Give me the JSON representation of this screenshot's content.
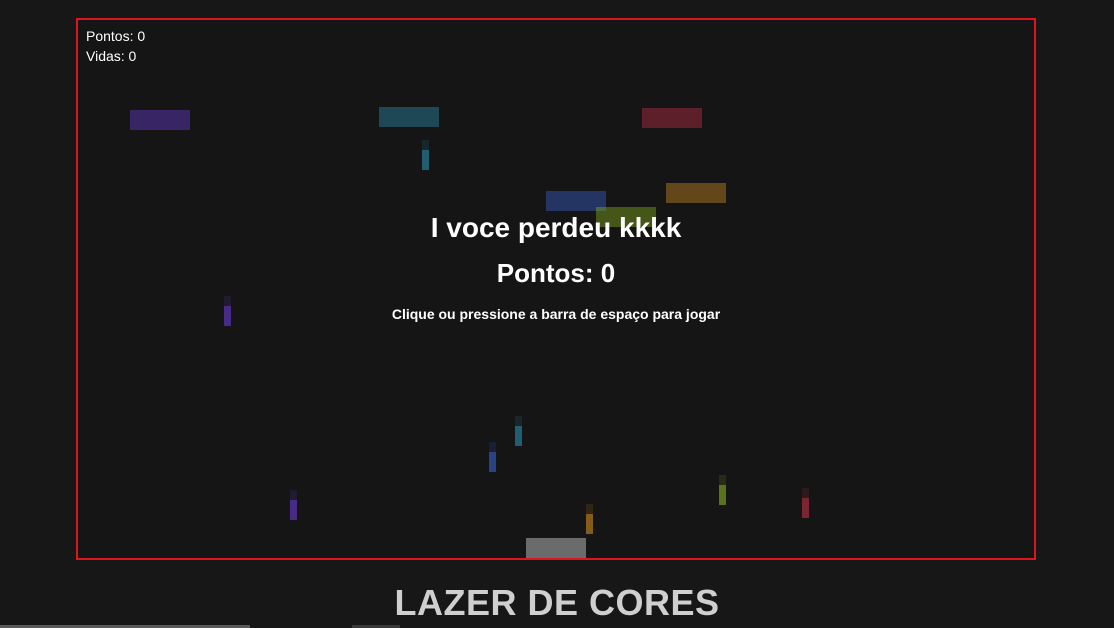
{
  "hud": {
    "points_label": "Pontos: 0",
    "lives_label": "Vidas: 0"
  },
  "game_over": {
    "title": "I voce perdeu kkkk",
    "score": "Pontos: 0",
    "hint": "Clique ou pressione a barra de espaço para jogar"
  },
  "footer": {
    "title": "LAZER DE CORES"
  },
  "colors": {
    "border": "#e0141e",
    "purple": "#6a3bd1",
    "teal": "#2a8fb0",
    "crimson": "#c0304a",
    "blue": "#3a5fd0",
    "orange": "#d08a20",
    "green": "#88b020",
    "paddle": "#6b6b6b"
  }
}
